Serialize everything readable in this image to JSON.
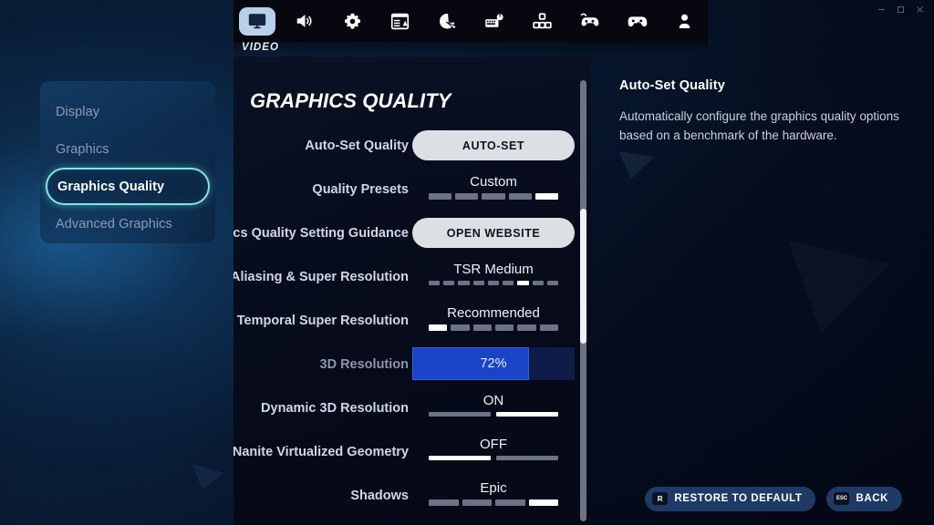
{
  "window": {
    "minimize_label": "–",
    "maximize_label": "▭",
    "close_label": "×"
  },
  "tabbar": {
    "active_tab_label": "VIDEO",
    "tabs": [
      {
        "icon": "monitor-icon",
        "name": "video",
        "active": true
      },
      {
        "icon": "speaker-icon",
        "name": "audio",
        "active": false
      },
      {
        "icon": "gear-icon",
        "name": "game",
        "active": false
      },
      {
        "icon": "hud-layout-icon",
        "name": "hud-layout",
        "active": false
      },
      {
        "icon": "accessibility-icon",
        "name": "accessibility",
        "active": false
      },
      {
        "icon": "keyboard-mouse-icon",
        "name": "input",
        "active": false
      },
      {
        "icon": "keybinds-icon",
        "name": "keybinds",
        "active": false
      },
      {
        "icon": "controller-cfg-icon",
        "name": "controller",
        "active": false
      },
      {
        "icon": "gamepad-icon",
        "name": "gamepad",
        "active": false
      },
      {
        "icon": "account-icon",
        "name": "account",
        "active": false
      }
    ]
  },
  "sidebar": {
    "items": [
      {
        "label": "Display",
        "selected": false
      },
      {
        "label": "Graphics",
        "selected": false
      },
      {
        "label": "Graphics Quality",
        "selected": true
      },
      {
        "label": "Advanced Graphics",
        "selected": false
      }
    ]
  },
  "main": {
    "title": "GRAPHICS QUALITY",
    "rows": [
      {
        "label": "Auto-Set Quality",
        "type": "button",
        "button_label": "AUTO-SET",
        "dim": false
      },
      {
        "label": "Quality Presets",
        "type": "segmented",
        "value": "Custom",
        "segments": 5,
        "active_index": 5,
        "dim": false
      },
      {
        "label": "Graphics Quality Setting Guidance",
        "type": "button",
        "button_label": "OPEN WEBSITE",
        "dim": false
      },
      {
        "label": "Anti-Aliasing & Super Resolution",
        "type": "segmented",
        "value": "TSR Medium",
        "segments": 9,
        "active_index": 7,
        "dim": false
      },
      {
        "label": "Temporal Super Resolution",
        "type": "segmented",
        "value": "Recommended",
        "segments": 6,
        "active_index": 1,
        "dim": false
      },
      {
        "label": "3D Resolution",
        "type": "slider",
        "value": "72%",
        "percent": 72,
        "dim": true
      },
      {
        "label": "Dynamic 3D Resolution",
        "type": "toggle",
        "value": "ON",
        "segments": 2,
        "active_index": 2,
        "dim": false
      },
      {
        "label": "Nanite Virtualized Geometry",
        "type": "toggle",
        "value": "OFF",
        "segments": 2,
        "active_index": 1,
        "dim": false
      },
      {
        "label": "Shadows",
        "type": "segmented",
        "value": "Epic",
        "segments": 4,
        "active_index": 4,
        "dim": false
      }
    ]
  },
  "info": {
    "title": "Auto-Set Quality",
    "body": "Automatically configure the graphics quality options based on a benchmark of the hardware."
  },
  "footer": {
    "buttons": [
      {
        "key": "R",
        "label": "RESTORE TO DEFAULT",
        "name": "restore-to-default-button"
      },
      {
        "key": "ESC",
        "label": "BACK",
        "name": "back-button"
      }
    ]
  },
  "colors": {
    "accent_cyan": "#7fe6e2",
    "slider_blue": "#1a44c8",
    "slider_track": "#0e1c47",
    "pill_button": "#dcdfe4",
    "footer_button": "#2e5896",
    "segment_off": "#6b7386",
    "segment_on": "#ffffff"
  }
}
